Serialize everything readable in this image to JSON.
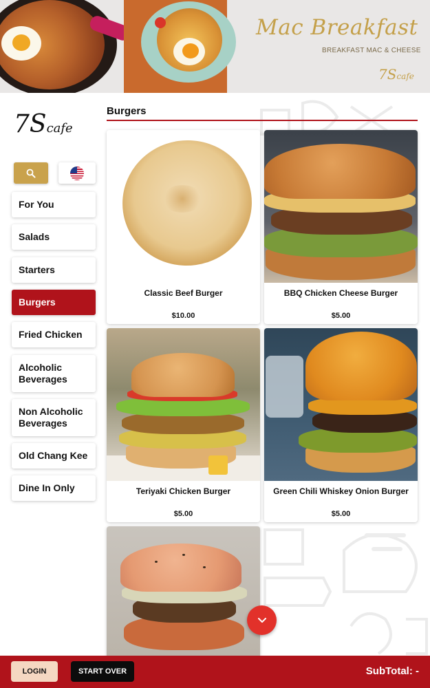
{
  "banner": {
    "title": "Mac Breakfast",
    "subtitle": "BREAKFAST MAC & CHEESE",
    "logo_main": "7S",
    "logo_sub": "cafe"
  },
  "brand": {
    "logo_main": "7S",
    "logo_sub": "cafe",
    "accent": "#b0131b",
    "gold": "#c9a24c"
  },
  "toolbar": {
    "search_icon": "search-icon",
    "language_icon": "us-flag-icon"
  },
  "categories": [
    {
      "label": "For You"
    },
    {
      "label": "Salads"
    },
    {
      "label": "Starters"
    },
    {
      "label": "Burgers",
      "active": true
    },
    {
      "label": "Fried Chicken"
    },
    {
      "label": "Alcoholic Beverages"
    },
    {
      "label": "Non Alcoholic Beverages"
    },
    {
      "label": "Old Chang Kee"
    },
    {
      "label": "Dine In Only"
    }
  ],
  "section": {
    "title": "Burgers"
  },
  "products": [
    {
      "name": "Classic Beef Burger",
      "price": "$10.00"
    },
    {
      "name": "BBQ Chicken Cheese Burger",
      "price": "$5.00"
    },
    {
      "name": "Teriyaki Chicken Burger",
      "price": "$5.00"
    },
    {
      "name": "Green Chili Whiskey Onion Burger",
      "price": "$5.00"
    },
    {
      "name": "",
      "price": ""
    }
  ],
  "footer": {
    "login_label": "LOGIN",
    "start_over_label": "START OVER",
    "subtotal_label": "SubTotal: -"
  }
}
